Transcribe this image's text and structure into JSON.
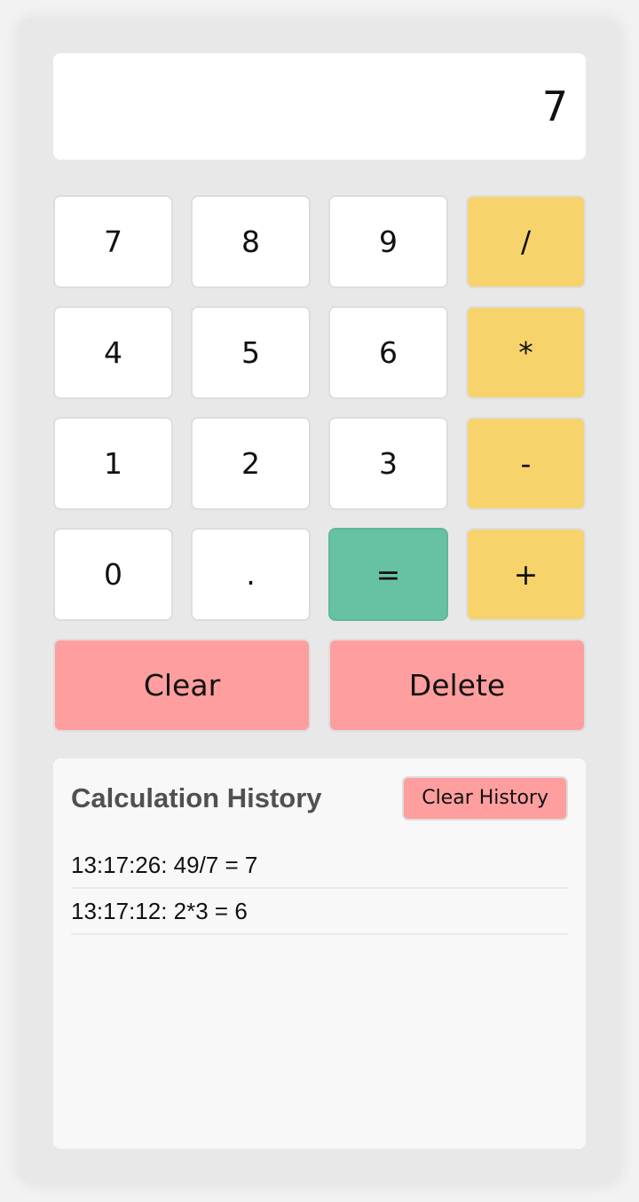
{
  "display": {
    "value": "7"
  },
  "keypad": {
    "keys": [
      {
        "label": "7",
        "name": "key-7"
      },
      {
        "label": "8",
        "name": "key-8"
      },
      {
        "label": "9",
        "name": "key-9"
      },
      {
        "label": "/",
        "name": "key-divide"
      },
      {
        "label": "4",
        "name": "key-4"
      },
      {
        "label": "5",
        "name": "key-5"
      },
      {
        "label": "6",
        "name": "key-6"
      },
      {
        "label": "*",
        "name": "key-multiply"
      },
      {
        "label": "1",
        "name": "key-1"
      },
      {
        "label": "2",
        "name": "key-2"
      },
      {
        "label": "3",
        "name": "key-3"
      },
      {
        "label": "-",
        "name": "key-subtract"
      },
      {
        "label": "0",
        "name": "key-0"
      },
      {
        "label": ".",
        "name": "key-decimal"
      },
      {
        "label": "=",
        "name": "key-equals"
      },
      {
        "label": "+",
        "name": "key-add"
      },
      {
        "label": "Clear",
        "name": "clear-button"
      },
      {
        "label": "Delete",
        "name": "delete-button"
      }
    ]
  },
  "history": {
    "title": "Calculation History",
    "clear_label": "Clear History",
    "entries": [
      "13:17:26: 49/7 = 7",
      "13:17:12: 2*3 = 6"
    ]
  },
  "colors": {
    "operator": "#f7d36b",
    "equals": "#67c2a4",
    "action": "#ff9e9e",
    "frame": "#e8e8e8"
  }
}
